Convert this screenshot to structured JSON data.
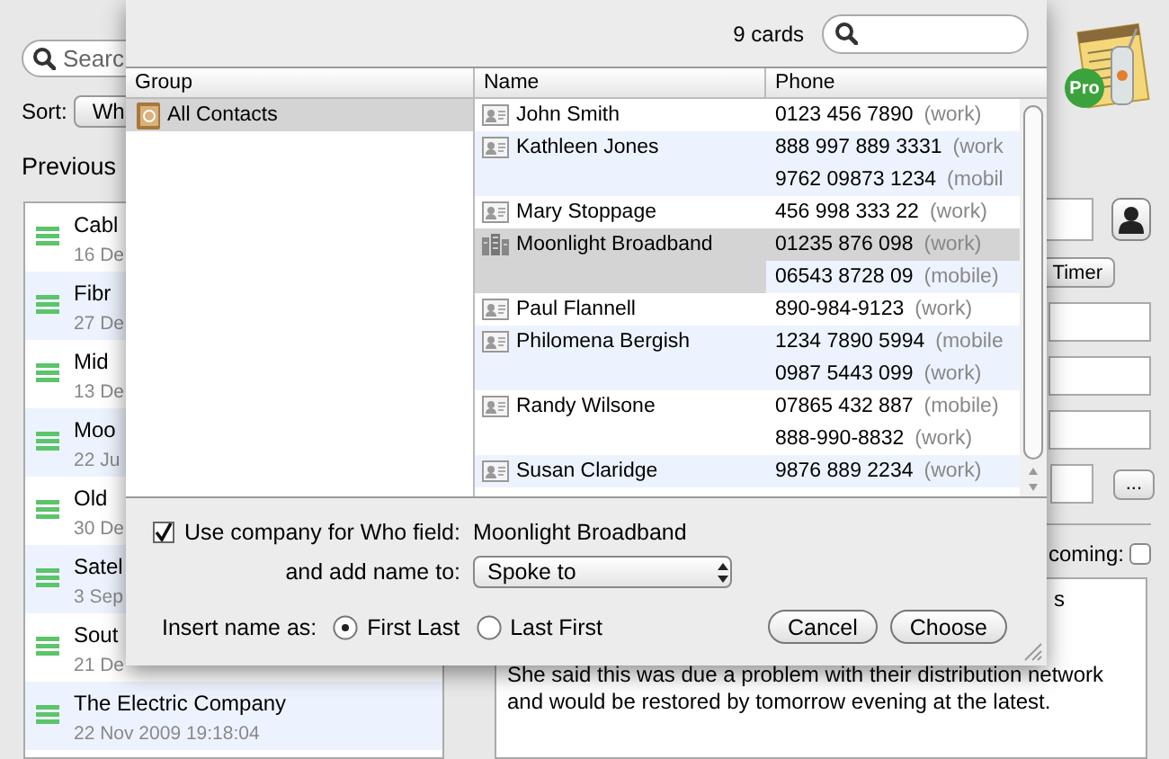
{
  "sidebar": {
    "search": {
      "placeholder": "Searc"
    },
    "sort_label": "Sort:",
    "sort_value": "Wh",
    "heading": "Previous",
    "items": [
      {
        "title": "Cabl",
        "date": "16 De"
      },
      {
        "title": "Fibr",
        "date": "27 De"
      },
      {
        "title": "Mid",
        "date": "13 De"
      },
      {
        "title": "Moo",
        "date": "22 Ju"
      },
      {
        "title": "Old",
        "date": "30 De"
      },
      {
        "title": "Satel",
        "date": "3 Sep"
      },
      {
        "title": "Sout",
        "date": "21 De"
      },
      {
        "title": "The Electric Company",
        "date": "22 Nov 2009 19:18:04"
      }
    ]
  },
  "detail": {
    "app_badge": "Pro",
    "timer_button": "Timer",
    "more_button": "...",
    "incoming": {
      "label": "coming:",
      "checked": false
    },
    "notes": {
      "first_line_end": "s",
      "paragraph": "She said this was due a problem with their distribution network and would be restored by tomorrow evening at the latest."
    }
  },
  "sheet": {
    "count": "9 cards",
    "columns": [
      "Group",
      "Name",
      "Phone"
    ],
    "groups": [
      {
        "name": "All Contacts",
        "selected": true
      }
    ],
    "contacts": [
      {
        "name": "John Smith",
        "kind": "person",
        "selected": false,
        "phones": [
          {
            "number": "0123 456 7890",
            "label": "(work)",
            "selected": false
          }
        ]
      },
      {
        "name": "Kathleen Jones",
        "kind": "person",
        "selected": false,
        "phones": [
          {
            "number": "888 997 889 3331",
            "label": "(work",
            "selected": false
          },
          {
            "number": "9762 09873 1234",
            "label": "(mobil",
            "selected": false
          }
        ]
      },
      {
        "name": "Mary Stoppage",
        "kind": "person",
        "selected": false,
        "phones": [
          {
            "number": "456 998 333 22",
            "label": "(work)",
            "selected": false
          }
        ]
      },
      {
        "name": "Moonlight Broadband",
        "kind": "company",
        "selected": true,
        "phones": [
          {
            "number": "01235 876 098",
            "label": "(work)",
            "selected": true
          },
          {
            "number": "06543 8728 09",
            "label": "(mobile)",
            "selected": false
          }
        ]
      },
      {
        "name": "Paul Flannell",
        "kind": "person",
        "selected": false,
        "phones": [
          {
            "number": "890-984-9123",
            "label": "(work)",
            "selected": false
          }
        ]
      },
      {
        "name": "Philomena Bergish",
        "kind": "person",
        "selected": false,
        "phones": [
          {
            "number": "1234 7890 5994",
            "label": "(mobile",
            "selected": false
          },
          {
            "number": "0987 5443 099",
            "label": "(work)",
            "selected": false
          }
        ]
      },
      {
        "name": "Randy Wilsone",
        "kind": "person",
        "selected": false,
        "phones": [
          {
            "number": "07865 432 887",
            "label": "(mobile)",
            "selected": false
          },
          {
            "number": "888-990-8832",
            "label": "(work)",
            "selected": false
          }
        ]
      },
      {
        "name": "Susan Claridge",
        "kind": "person",
        "selected": false,
        "phones": [
          {
            "number": "9876 889 2234",
            "label": "(work)",
            "selected": false
          }
        ]
      }
    ],
    "use_company": {
      "label": "Use company for Who field:",
      "checked": true,
      "value": "Moonlight Broadband"
    },
    "add_name": {
      "label": "and add name to:",
      "value": "Spoke to"
    },
    "insert_as": {
      "label": "Insert name as:",
      "options": [
        {
          "label": "First Last",
          "selected": true
        },
        {
          "label": "Last First",
          "selected": false
        }
      ]
    },
    "buttons": [
      "Cancel",
      "Choose"
    ]
  }
}
